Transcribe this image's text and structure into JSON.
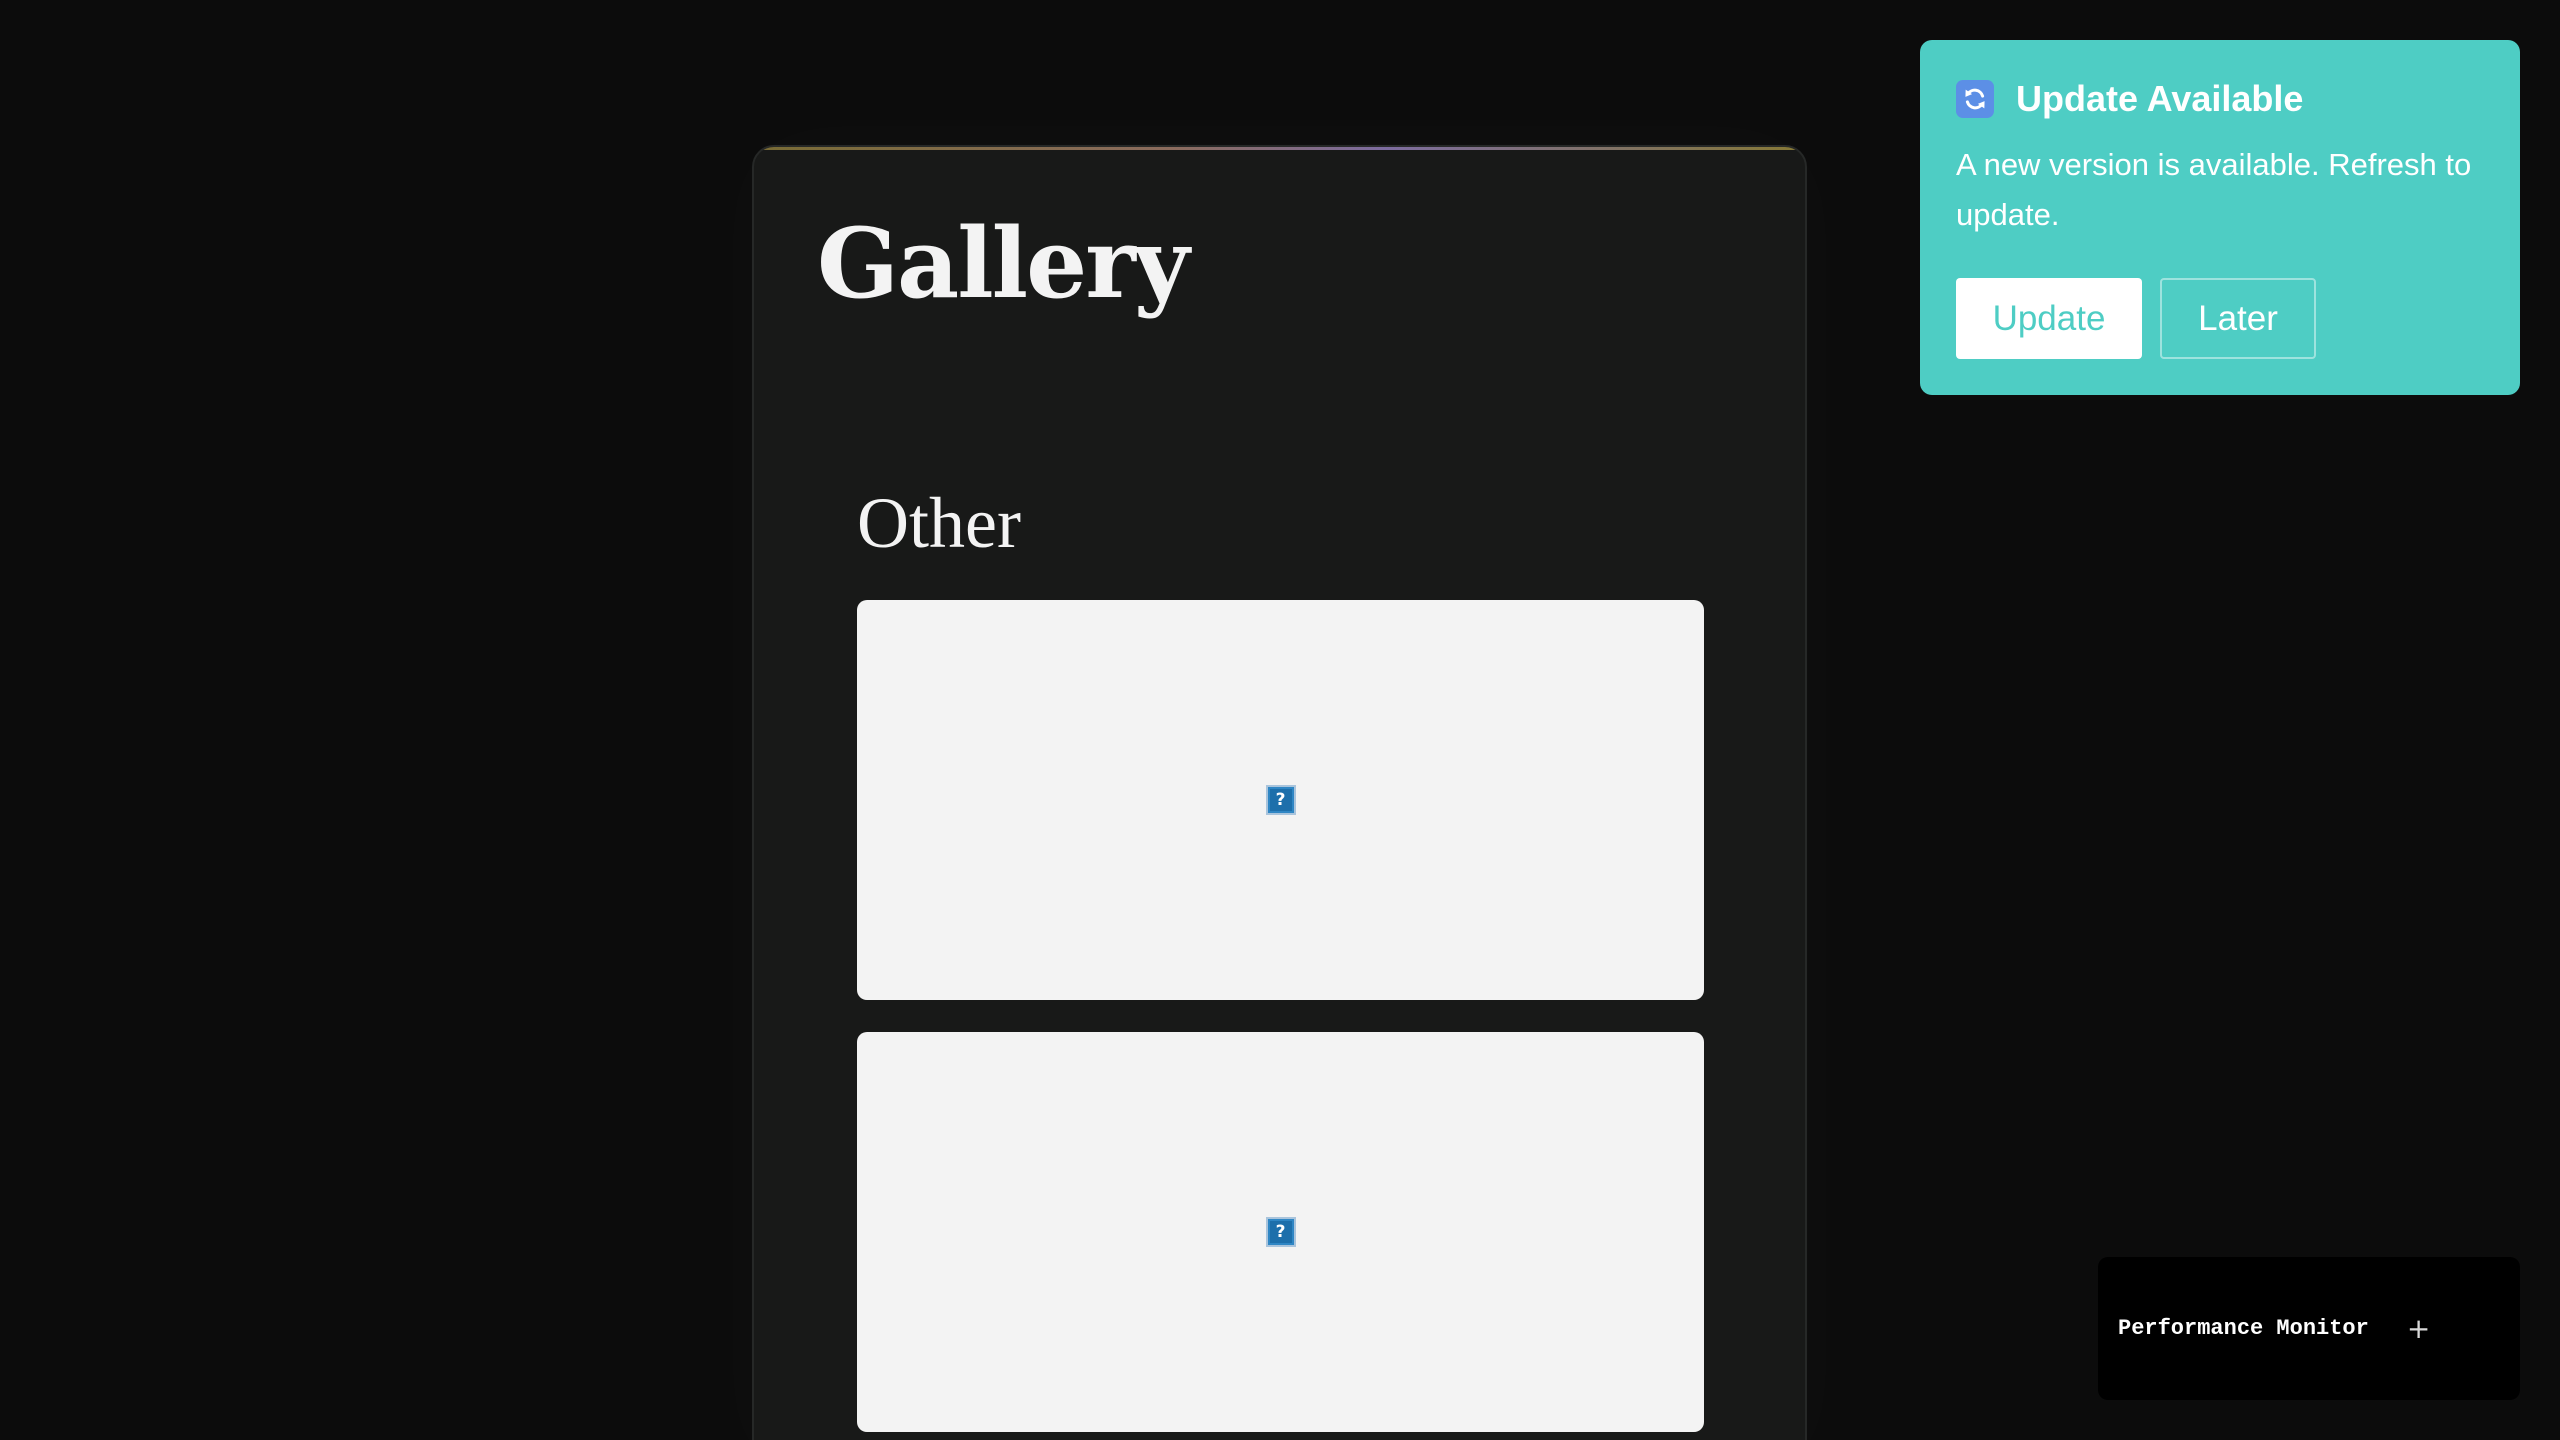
{
  "gallery": {
    "title": "Gallery",
    "sections": [
      {
        "heading": "Other",
        "items": [
          {
            "image_icon": "broken-image-icon",
            "image_glyph": "?"
          },
          {
            "image_icon": "broken-image-icon",
            "image_glyph": "?"
          }
        ]
      }
    ]
  },
  "update_toast": {
    "icon": "refresh-icon",
    "title": "Update Available",
    "message": "A new version is available. Refresh to update.",
    "update_label": "Update",
    "later_label": "Later",
    "background_color": "#4ecdc4"
  },
  "performance_monitor": {
    "title": "Performance Monitor",
    "toggle_symbol": "+"
  },
  "colors": {
    "page_background": "#0c0c0c",
    "card_background": "#181918",
    "item_background": "#f3f3f3"
  }
}
